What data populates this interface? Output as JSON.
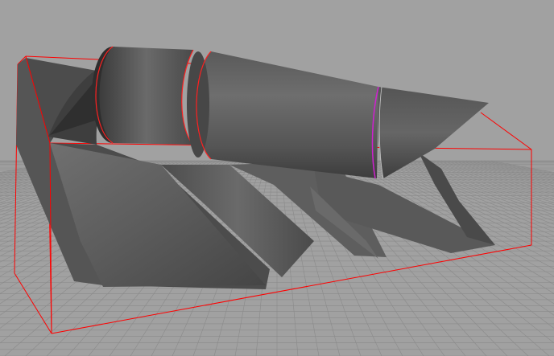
{
  "viewport": {
    "background": "#a1a1a1",
    "grid_color": "#8a8a8a",
    "bounding_box_color": "#ff0000",
    "selection_edge_color": "#d020d0",
    "mesh_dark": "#3a3a3a",
    "mesh_mid": "#5a5a5a",
    "mesh_light": "#787878"
  },
  "scene": {
    "object": "surface-model",
    "shading": "smooth-shaded",
    "grid": true,
    "bounding_box_visible": true,
    "selected_edge_visible": true
  }
}
